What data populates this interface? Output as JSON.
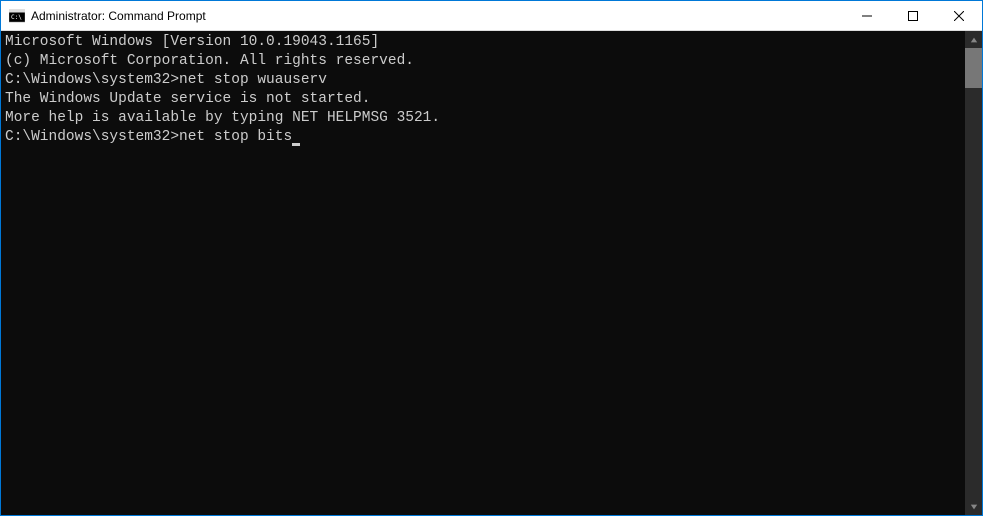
{
  "titlebar": {
    "title": "Administrator: Command Prompt"
  },
  "terminal": {
    "line1": "Microsoft Windows [Version 10.0.19043.1165]",
    "line2": "(c) Microsoft Corporation. All rights reserved.",
    "blank1": "",
    "prompt1": "C:\\Windows\\system32>",
    "command1": "net stop wuauserv",
    "response1": "The Windows Update service is not started.",
    "blank2": "",
    "response2": "More help is available by typing NET HELPMSG 3521.",
    "blank3": "",
    "blank4": "",
    "prompt2": "C:\\Windows\\system32>",
    "command2": "net stop bits"
  }
}
